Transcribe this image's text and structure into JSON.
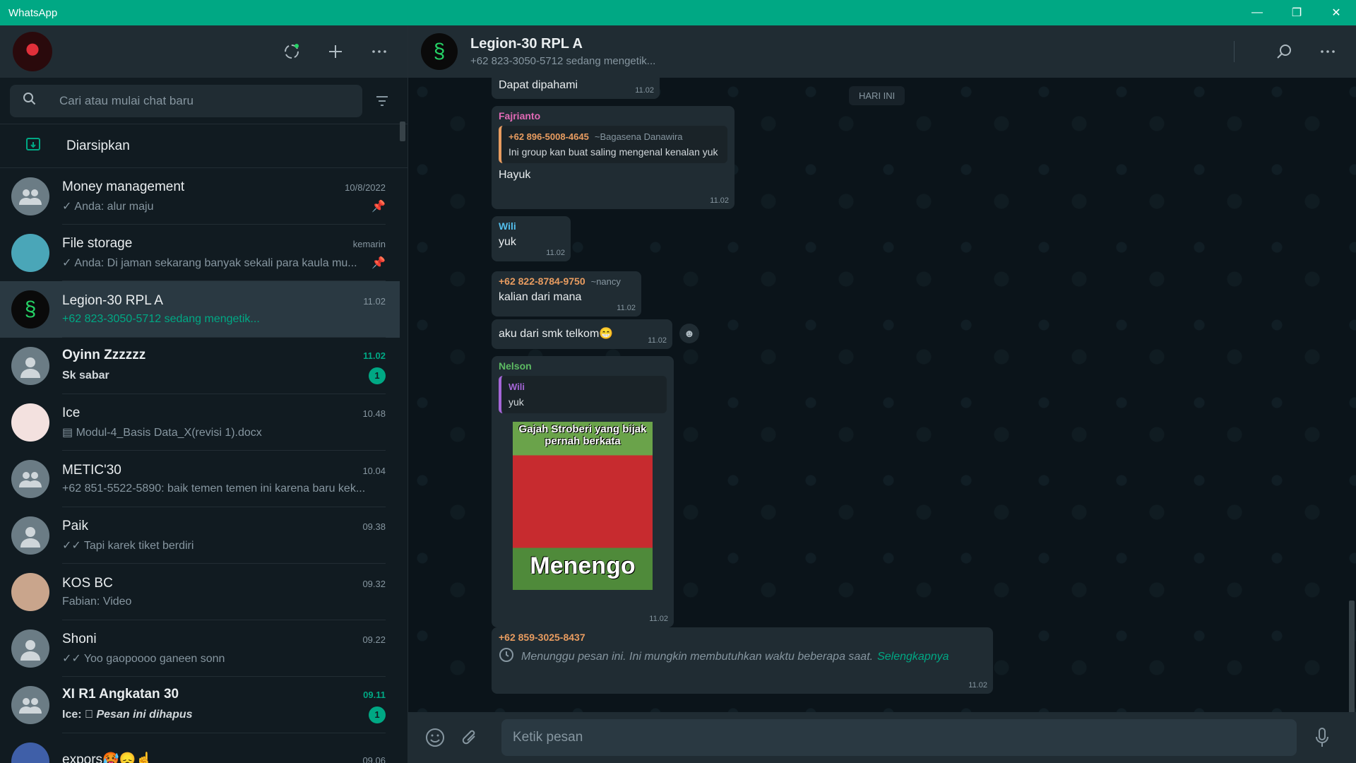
{
  "window": {
    "title": "WhatsApp",
    "minimize": "—",
    "restore": "❐",
    "close": "✕"
  },
  "sidebar": {
    "search_placeholder": "Cari atau mulai chat baru",
    "archived_label": "Diarsipkan",
    "chats": [
      {
        "name": "Money management",
        "time": "10/8/2022",
        "preview": "Anda: alur maju",
        "tick": "✓",
        "pinned": true,
        "avatar": "group"
      },
      {
        "name": "File storage",
        "time": "kemarin",
        "preview": "Anda: Di jaman sekarang banyak sekali para kaula mu...",
        "tick": "✓",
        "pinned": true,
        "avatar": "custom"
      },
      {
        "name": "Legion-30 RPL A",
        "time": "11.02",
        "preview": "+62 823-3050-5712 sedang mengetik...",
        "active": true,
        "avatar": "legion"
      },
      {
        "name": "Oyinn Zzzzzz",
        "time": "11.02",
        "preview": "Sk sabar",
        "unread": "1",
        "avatar": "person"
      },
      {
        "name": "Ice",
        "time": "10.48",
        "preview": "Modul-4_Basis Data_X(revisi 1).docx",
        "avatar": "custom"
      },
      {
        "name": "METIC'30",
        "time": "10.04",
        "preview": "+62 851-5522-5890: baik temen temen ini karena baru kek...",
        "avatar": "group"
      },
      {
        "name": "Paik",
        "time": "09.38",
        "preview": "Tapi karek tiket berdiri",
        "tick": "✓✓",
        "avatar": "person"
      },
      {
        "name": "KOS BC",
        "time": "09.32",
        "preview": "Fabian: Video",
        "avatar": "custom"
      },
      {
        "name": "Shoni",
        "time": "09.22",
        "preview": "Yoo gaopoooo ganeen sonn",
        "tick": "✓✓",
        "avatar": "person"
      },
      {
        "name": "XI R1 Angkatan 30",
        "time": "09.11",
        "preview_sender": "Ice:",
        "preview": "Pesan ini dihapus",
        "unread": "1",
        "avatar": "group"
      },
      {
        "name": "expors🥵😞☝",
        "time": "09.06",
        "preview": "",
        "avatar": "custom"
      }
    ]
  },
  "chat": {
    "title": "Legion-30 RPL A",
    "subtitle": "+62 823-3050-5712 sedang mengetik...",
    "day_chip": "HARI INI",
    "messages": {
      "m1": {
        "text": "Dapat dipahami",
        "time": "11.02"
      },
      "m2": {
        "sender": "Fajrianto",
        "quote_name": "+62 896-5008-4645",
        "quote_alias": "~Bagasena Danawira",
        "quote_text": "Ini group kan buat saling mengenal kenalan yuk",
        "text": "Hayuk",
        "time": "11.02"
      },
      "m3": {
        "sender": "Wili",
        "text": "yuk",
        "time": "11.02"
      },
      "m4": {
        "sender": "+62 822-8784-9750",
        "alias": "~nancy",
        "text": "kalian dari mana",
        "time": "11.02"
      },
      "m5": {
        "text": "aku dari smk telkom😁",
        "time": "11.02"
      },
      "m6": {
        "sender": "Nelson",
        "quote_name": "Wili",
        "quote_text": "yuk",
        "sticker_top": "Gajah Stroberi yang bijak pernah berkata",
        "sticker_bottom": "Menengo",
        "time": "11.02"
      },
      "m7": {
        "sender": "+62 859-3025-8437",
        "waiting": "Menunggu pesan ini. Ini mungkin membutuhkan waktu beberapa saat.",
        "link": "Selengkapnya",
        "time": "11.02"
      }
    },
    "composer_placeholder": "Ketik pesan"
  }
}
